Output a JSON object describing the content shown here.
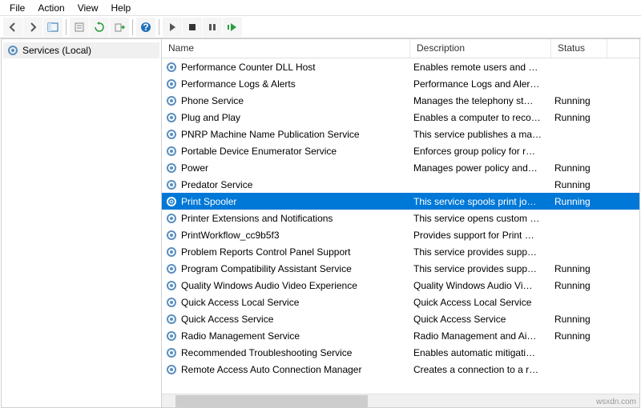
{
  "menu": {
    "file": "File",
    "action": "Action",
    "view": "View",
    "help": "Help"
  },
  "tree": {
    "root": "Services (Local)"
  },
  "columns": {
    "name": "Name",
    "description": "Description",
    "status": "Status"
  },
  "selected": 8,
  "services": [
    {
      "name": "Performance Counter DLL Host",
      "desc": "Enables remote users and …",
      "status": ""
    },
    {
      "name": "Performance Logs & Alerts",
      "desc": "Performance Logs and Aler…",
      "status": ""
    },
    {
      "name": "Phone Service",
      "desc": "Manages the telephony st…",
      "status": "Running"
    },
    {
      "name": "Plug and Play",
      "desc": "Enables a computer to reco…",
      "status": "Running"
    },
    {
      "name": "PNRP Machine Name Publication Service",
      "desc": "This service publishes a ma…",
      "status": ""
    },
    {
      "name": "Portable Device Enumerator Service",
      "desc": "Enforces group policy for r…",
      "status": ""
    },
    {
      "name": "Power",
      "desc": "Manages power policy and…",
      "status": "Running"
    },
    {
      "name": "Predator Service",
      "desc": "",
      "status": "Running"
    },
    {
      "name": "Print Spooler",
      "desc": "This service spools print jo…",
      "status": "Running"
    },
    {
      "name": "Printer Extensions and Notifications",
      "desc": "This service opens custom …",
      "status": ""
    },
    {
      "name": "PrintWorkflow_cc9b5f3",
      "desc": "Provides support for Print …",
      "status": ""
    },
    {
      "name": "Problem Reports Control Panel Support",
      "desc": "This service provides supp…",
      "status": ""
    },
    {
      "name": "Program Compatibility Assistant Service",
      "desc": "This service provides supp…",
      "status": "Running"
    },
    {
      "name": "Quality Windows Audio Video Experience",
      "desc": "Quality Windows Audio Vi…",
      "status": "Running"
    },
    {
      "name": "Quick Access Local Service",
      "desc": "Quick Access Local Service",
      "status": ""
    },
    {
      "name": "Quick Access Service",
      "desc": "Quick Access Service",
      "status": "Running"
    },
    {
      "name": "Radio Management Service",
      "desc": "Radio Management and Ai…",
      "status": "Running"
    },
    {
      "name": "Recommended Troubleshooting Service",
      "desc": "Enables automatic mitigati…",
      "status": ""
    },
    {
      "name": "Remote Access Auto Connection Manager",
      "desc": "Creates a connection to a r…",
      "status": ""
    }
  ],
  "watermark": "wsxdn.com"
}
